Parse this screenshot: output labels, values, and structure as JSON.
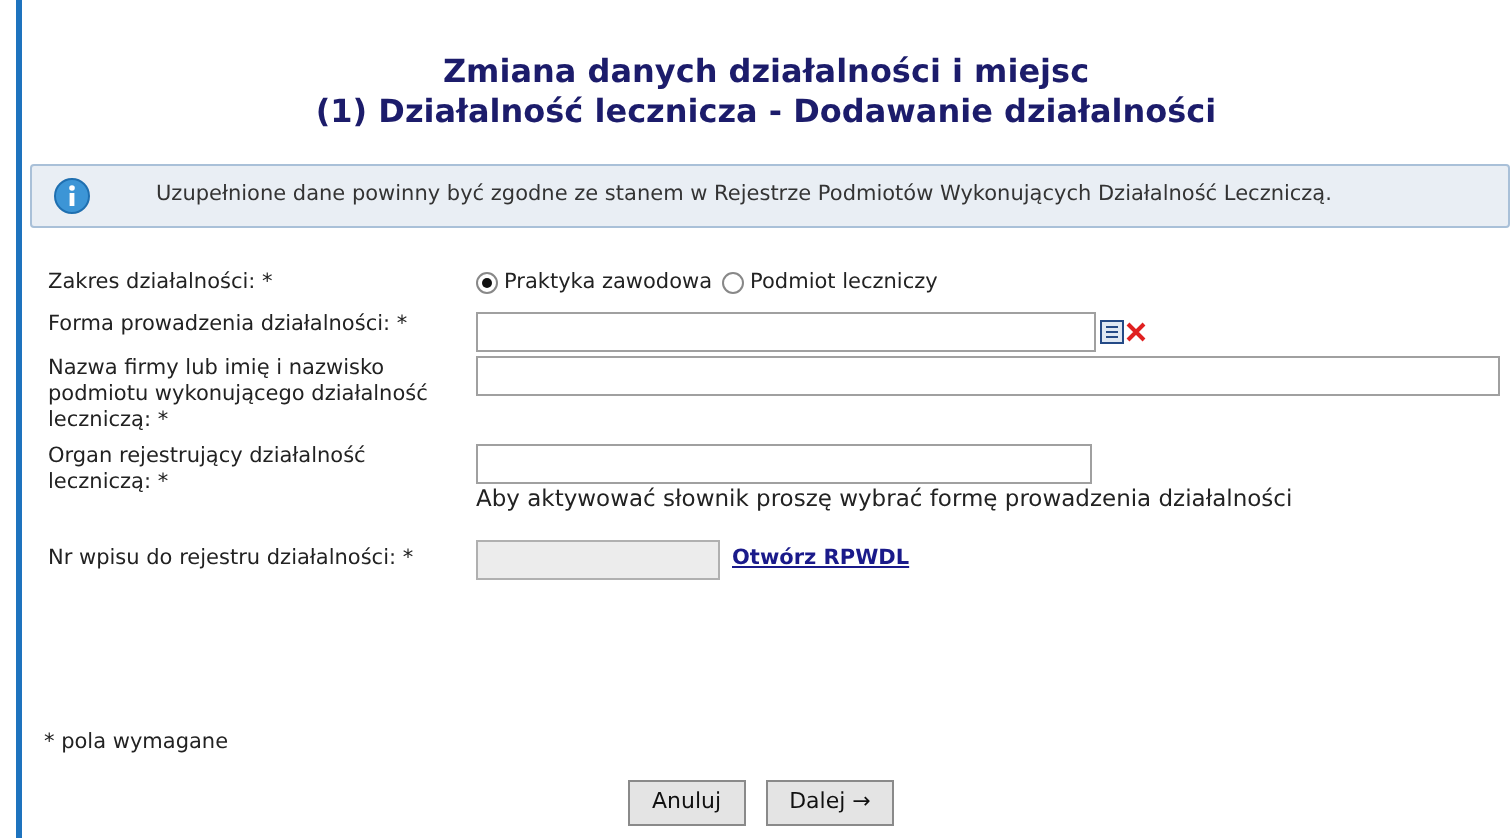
{
  "title": [
    "Zmiana danych działalności i miejsc",
    "(1) Działalność lecznicza - Dodawanie działalności"
  ],
  "info": {
    "text": "Uzupełnione dane powinny być zgodne ze stanem w Rejestrze Podmiotów Wykonujących Działalność Leczniczą."
  },
  "fields": [
    {
      "kind": "radio",
      "label": "Zakres działalności: *",
      "options": [
        {
          "label": "Praktyka zawodowa",
          "selected": true
        },
        {
          "label": "Podmiot leczniczy",
          "selected": false
        }
      ]
    },
    {
      "kind": "dictionary",
      "label": "Forma prowadzenia działalności: *"
    },
    {
      "kind": "wide",
      "label": "Nazwa firmy lub imię i nazwisko podmiotu wykonującego działalność leczniczą: *"
    },
    {
      "kind": "text",
      "label": "Organ rejestrujący działalność leczniczą: *",
      "hint": "Aby aktywować słownik proszę wybrać formę prowadzenia działalności"
    },
    {
      "kind": "readonly",
      "label": "Nr wpisu do rejestru działalności: *",
      "link": "Otwórz RPWDL",
      "disabled": true
    }
  ],
  "required_note": "* pola wymagane",
  "buttons": [
    "Anuluj",
    "Dalej →"
  ]
}
